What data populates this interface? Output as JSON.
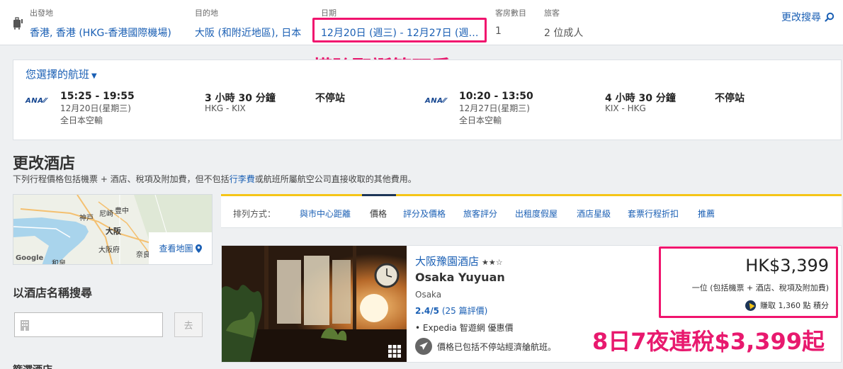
{
  "search_summary": {
    "origin_label": "出發地",
    "origin_value": "香港, 香港 (HKG-香港國際機場)",
    "destination_label": "目的地",
    "destination_value": "大阪 (和附近地區), 日本",
    "date_label": "日期",
    "date_value": "12月20日 (週三) - 12月27日 (週…",
    "rooms_label": "客房數目",
    "rooms_value": "1",
    "travelers_label": "旅客",
    "travelers_value": "2 位成人",
    "change_search": "更改搜尋"
  },
  "annotations": {
    "peak_season": "橫跨聖誕節旺季",
    "price_note": "8日7夜連稅$3,399起"
  },
  "selected_flights": {
    "title": "您選擇的航班",
    "outbound": {
      "airline_logo": "ANA",
      "time": "15:25 - 19:55",
      "date": "12月20日(星期三)",
      "airline": "全日本空輸",
      "duration": "3 小時 30 分鐘",
      "route": "HKG - KIX",
      "stops": "不停站"
    },
    "return": {
      "airline_logo": "ANA",
      "time": "10:20 - 13:50",
      "date": "12月27日(星期三)",
      "airline": "全日本空輸",
      "duration": "4 小時 30 分鐘",
      "route": "KIX - HKG",
      "stops": "不停站"
    }
  },
  "change_hotel": {
    "title": "更改酒店",
    "desc_before": "下列行程價格包括機票 + 酒店、稅項及附加費，但不包括",
    "desc_link": "行李費",
    "desc_after": "或航班所屬航空公司直接收取的其他費用。"
  },
  "map": {
    "labels": [
      "神戸",
      "尼崎",
      "豊中",
      "大阪",
      "大阪府",
      "奈良",
      "和泉"
    ],
    "google": "Google",
    "view_map": "查看地圖"
  },
  "search_by_name": {
    "title": "以酒店名稱搜尋",
    "go_button": "去",
    "cut_off_text": "篩選酒店"
  },
  "sort_bar": {
    "label": "排列方式：",
    "options": [
      "與市中心距離",
      "價格",
      "評分及價格",
      "旅客評分",
      "出租度假屋",
      "酒店星級",
      "套票行程折扣",
      "推薦"
    ],
    "active_index": 1
  },
  "hotel": {
    "name": "大阪豫園酒店",
    "stars_display": "★★☆",
    "star_rating": 2.5,
    "english_name": "Osaka Yuyuan",
    "city": "Osaka",
    "rating": "2.4/5",
    "reviews": "(25 篇評價)",
    "deal": "• Expedia 智遊網 優惠價",
    "flight_note": "價格已包括不停站經濟艙航班。",
    "price": "HK$3,399",
    "price_desc": "一位 (包括機票 + 酒店、稅項及附加費)",
    "points": "賺取 1,360 點 積分"
  },
  "colors": {
    "link": "#1a5fb4",
    "highlight": "#f0146e",
    "accent_yellow": "#f5c517",
    "navy": "#1d3557"
  }
}
